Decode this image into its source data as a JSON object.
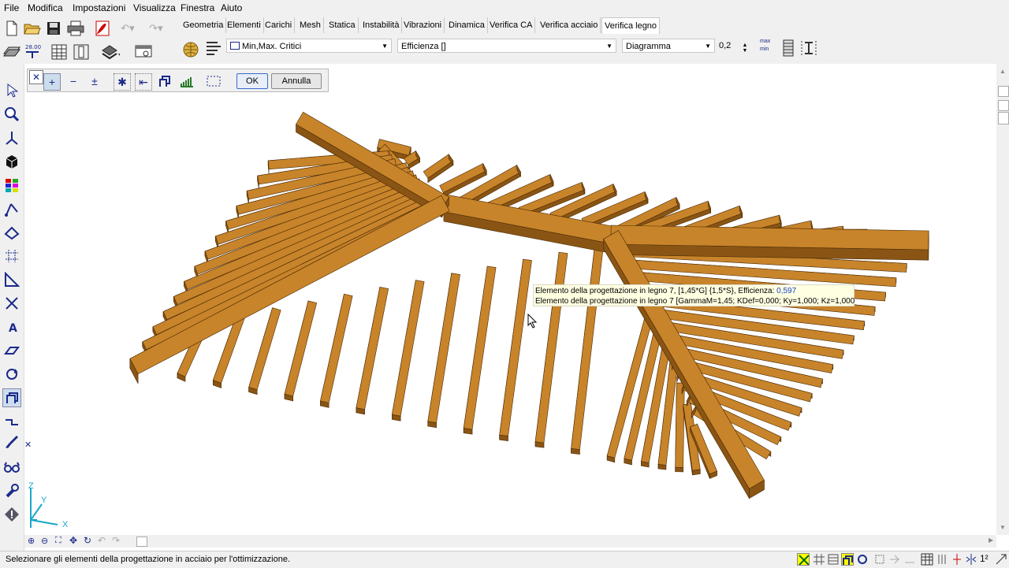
{
  "menubar": {
    "items": [
      "File",
      "Modifica",
      "Impostazioni",
      "Visualizza",
      "Finestra",
      "Aiuto"
    ]
  },
  "tabs": [
    "Geometria",
    "Elementi",
    "Carichi",
    "Mesh",
    "Statica",
    "Instabilità",
    "Vibrazioni",
    "Dinamica",
    "Verifica CA",
    "Verifica acciaio",
    "Verifica legno"
  ],
  "active_tab": "Verifica legno",
  "ribbon": {
    "combo_case": "Min,Max. Critici",
    "combo_quantity": "Efficienza []",
    "combo_display": "Diagramma",
    "scale_value": "0,2",
    "minmax_top": "max",
    "minmax_bottom": "min"
  },
  "selection_toolbar": {
    "ok_label": "OK",
    "cancel_label": "Annulla"
  },
  "tooltip": {
    "line1_prefix": "Elemento della progettazione in legno 7, [1,45*G] {1,5*S}, Efficienza: ",
    "line1_value": "0,597",
    "line2": "Elemento della progettazione in legno 7 [GammaM=1,45; KDef=0,000; Ky=1,000; Kz=1,000"
  },
  "axes": {
    "z": "Z",
    "y": "Y",
    "x": "X"
  },
  "status": {
    "text": "Selezionare gli elementi della progettazione in acciaio per l'ottimizzazione."
  },
  "colors": {
    "wood_top": "#c8842a",
    "wood_side": "#8a5514",
    "wood_edge": "#4a2a06",
    "tooltip_value": "#1a3ec8",
    "axis": "#1aa7c8"
  }
}
